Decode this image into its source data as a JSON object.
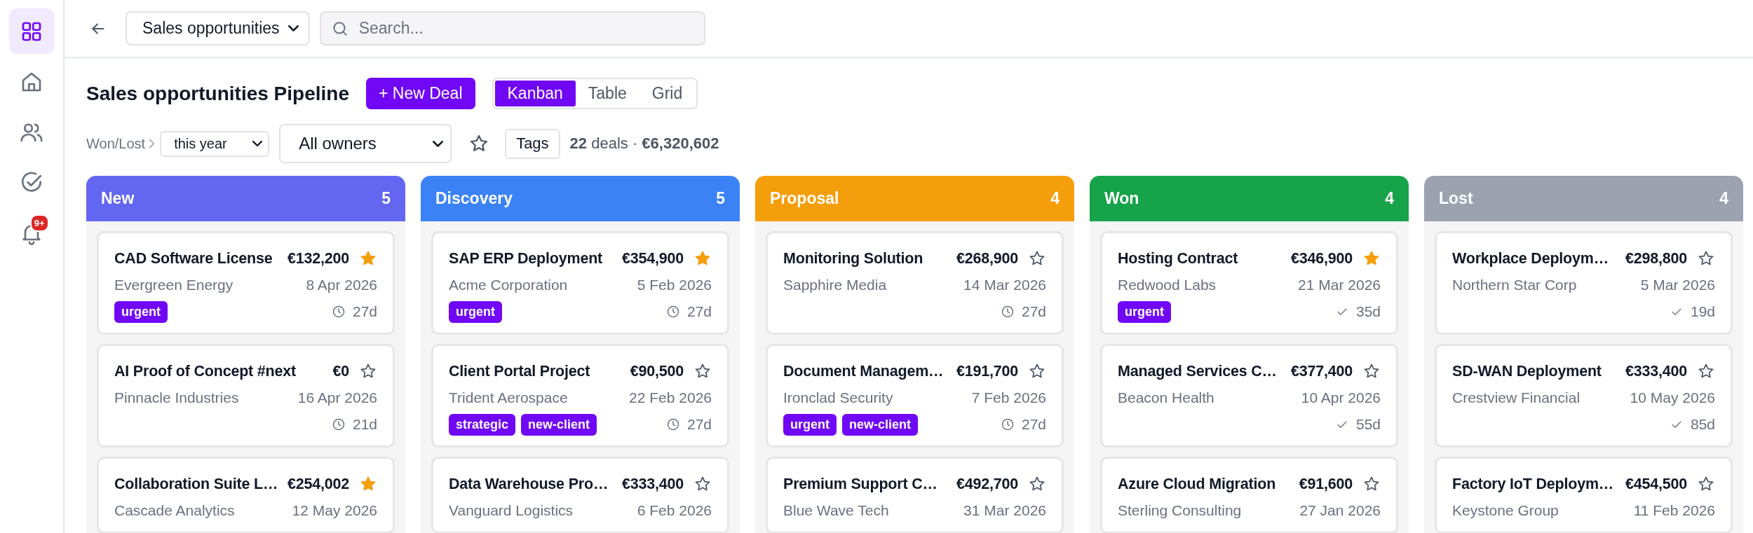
{
  "sidebar": {
    "items": [
      {
        "kind": "grid",
        "selected": true
      },
      {
        "kind": "home",
        "selected": false
      },
      {
        "kind": "users",
        "selected": false
      },
      {
        "kind": "check",
        "selected": false
      },
      {
        "kind": "bell",
        "selected": false,
        "badge": "9+"
      }
    ]
  },
  "top_bar": {
    "view_select": "Sales opportunities",
    "search": {
      "placeholder": "Search..."
    }
  },
  "toolbar": {
    "title": "Sales opportunities Pipeline",
    "new_button": "+ New Deal",
    "views": [
      {
        "label": "Kanban",
        "selected": true
      },
      {
        "label": "Table",
        "selected": false
      },
      {
        "label": "Grid",
        "selected": false
      }
    ],
    "filters": {
      "breadcrumb": "Won/Lost",
      "period": "this year",
      "owner": "All owners",
      "starred_only": false,
      "tags": "Tags",
      "summary": "**22** deals · **€6,320,602**"
    }
  },
  "columns": [
    {
      "name": "New",
      "count": "5",
      "color": "#6366f1",
      "deals": [
        {
          "title": "CAD Software License",
          "amount": "€132,200",
          "starred": true,
          "company": "Evergreen Energy",
          "date": "8 Apr 2026",
          "tags": [
            "urgent"
          ],
          "age": {
            "kind": "clock",
            "text": "27d"
          }
        },
        {
          "title": "AI Proof of Concept #next",
          "amount": "€0",
          "starred": false,
          "company": "Pinnacle Industries",
          "date": "16 Apr 2026",
          "age": {
            "kind": "clock",
            "text": "21d"
          }
        },
        {
          "title": "Collaboration Suite L…",
          "amount": "€254,002",
          "starred": true,
          "company": "Cascade Analytics",
          "date": "12 May 2026"
        }
      ]
    },
    {
      "name": "Discovery",
      "count": "5",
      "color": "#3b82f6",
      "deals": [
        {
          "title": "SAP ERP Deployment",
          "amount": "€354,900",
          "starred": true,
          "company": "Acme Corporation",
          "date": "5 Feb 2026",
          "tags": [
            "urgent"
          ],
          "age": {
            "kind": "clock",
            "text": "27d"
          }
        },
        {
          "title": "Client Portal Project",
          "amount": "€90,500",
          "starred": false,
          "company": "Trident Aerospace",
          "date": "22 Feb 2026",
          "tags": [
            "strategic",
            "new-client"
          ],
          "age": {
            "kind": "clock",
            "text": "27d"
          }
        },
        {
          "title": "Data Warehouse Pro…",
          "amount": "€333,400",
          "starred": false,
          "company": "Vanguard Logistics",
          "date": "6 Feb 2026"
        }
      ]
    },
    {
      "name": "Proposal",
      "count": "4",
      "color": "#f59e0b",
      "deals": [
        {
          "title": "Monitoring Solution",
          "amount": "€268,900",
          "starred": false,
          "company": "Sapphire Media",
          "date": "14 Mar 2026",
          "age": {
            "kind": "clock",
            "text": "27d"
          }
        },
        {
          "title": "Document Managem…",
          "amount": "€191,700",
          "starred": false,
          "company": "Ironclad Security",
          "date": "7 Feb 2026",
          "tags": [
            "urgent",
            "new-client"
          ],
          "age": {
            "kind": "clock",
            "text": "27d"
          }
        },
        {
          "title": "Premium Support C…",
          "amount": "€492,700",
          "starred": false,
          "company": "Blue Wave Tech",
          "date": "31 Mar 2026"
        }
      ]
    },
    {
      "name": "Won",
      "count": "4",
      "color": "#16a34a",
      "deals": [
        {
          "title": "Hosting Contract",
          "amount": "€346,900",
          "starred": true,
          "company": "Redwood Labs",
          "date": "21 Mar 2026",
          "tags": [
            "urgent"
          ],
          "age": {
            "kind": "check",
            "text": "35d"
          }
        },
        {
          "title": "Managed Services C…",
          "amount": "€377,400",
          "starred": false,
          "company": "Beacon Health",
          "date": "10 Apr 2026",
          "age": {
            "kind": "check",
            "text": "55d"
          }
        },
        {
          "title": "Azure Cloud Migration",
          "amount": "€91,600",
          "starred": false,
          "company": "Sterling Consulting",
          "date": "27 Jan 2026"
        }
      ]
    },
    {
      "name": "Lost",
      "count": "4",
      "color": "#9ca3af",
      "deals": [
        {
          "title": "Workplace Deploym…",
          "amount": "€298,800",
          "starred": false,
          "company": "Northern Star Corp",
          "date": "5 Mar 2026",
          "age": {
            "kind": "check",
            "text": "19d"
          }
        },
        {
          "title": "SD-WAN Deployment",
          "amount": "€333,400",
          "starred": false,
          "company": "Crestview Financial",
          "date": "10 May 2026",
          "age": {
            "kind": "check",
            "text": "85d"
          }
        },
        {
          "title": "Factory IoT Deploym…",
          "amount": "€454,500",
          "starred": false,
          "company": "Keystone Group",
          "date": "11 Feb 2026"
        }
      ]
    }
  ]
}
